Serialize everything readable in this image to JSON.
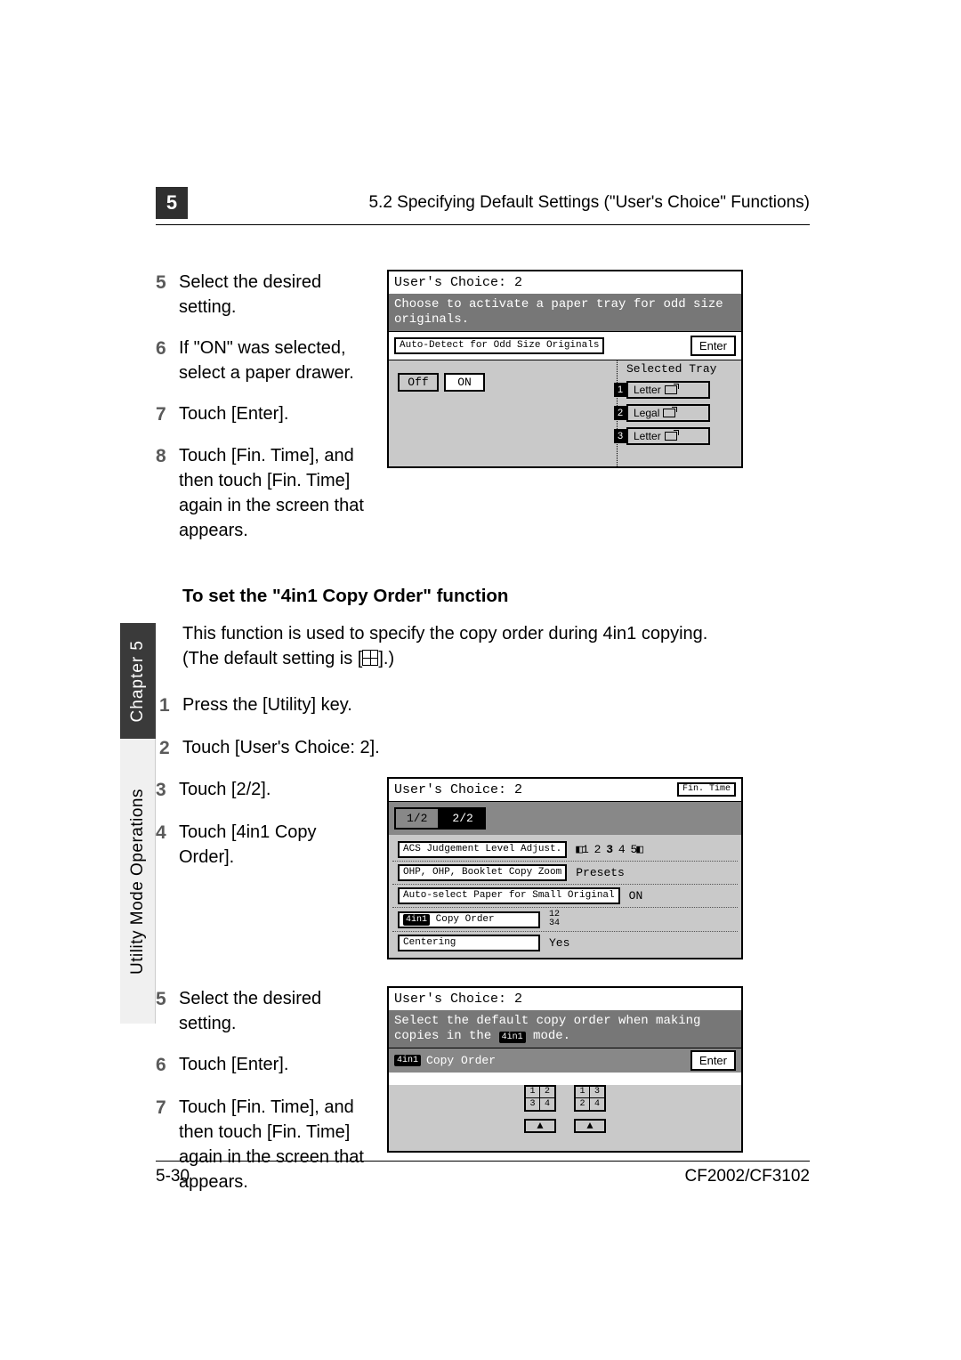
{
  "header": {
    "chapter_num": "5",
    "section_title": "5.2 Specifying Default Settings (\"User's Choice\" Functions)"
  },
  "side": {
    "dark": "Chapter 5",
    "light": "Utility Mode Operations"
  },
  "stepsA": {
    "s5": {
      "n": "5",
      "t": "Select the desired setting."
    },
    "s6": {
      "n": "6",
      "t": "If \"ON\" was selected, select a paper drawer."
    },
    "s7": {
      "n": "7",
      "t": "Touch [Enter]."
    },
    "s8": {
      "n": "8",
      "t": "Touch [Fin. Time], and then touch [Fin. Time] again in the screen that appears."
    }
  },
  "lcd1": {
    "title": "User's Choice: 2",
    "msg": "Choose to activate a paper tray for odd size originals.",
    "field": "Auto-Detect for Odd Size Originals",
    "enter": "Enter",
    "tray_label": "Selected Tray",
    "off": "Off",
    "on": "ON",
    "trays": [
      {
        "n": "1",
        "name": "Letter"
      },
      {
        "n": "2",
        "name": "Legal"
      },
      {
        "n": "3",
        "name": "Letter"
      }
    ]
  },
  "section2": {
    "heading": "To set the \"4in1 Copy Order\" function",
    "para1": "This function is used to specify the copy order during 4in1 copying.",
    "para2a": "(The default setting is [",
    "para2b": "].)"
  },
  "stepsB": {
    "s1": {
      "n": "1",
      "t": "Press the [Utility] key."
    },
    "s2": {
      "n": "2",
      "t": "Touch [User's Choice: 2]."
    },
    "s3": {
      "n": "3",
      "t": "Touch [2/2]."
    },
    "s4": {
      "n": "4",
      "t": "Touch [4in1 Copy Order]."
    }
  },
  "lcd2": {
    "title": "User's Choice: 2",
    "fin": "Fin. Time",
    "page1": "1/2",
    "page2": "2/2",
    "rows": [
      {
        "label": "ACS Judgement Level Adjust.",
        "value_type": "slider",
        "value": "12345"
      },
      {
        "label": "OHP, OHP, Booklet Copy Zoom",
        "value": "Presets"
      },
      {
        "label": "Auto-select Paper for Small Original",
        "value": "ON"
      },
      {
        "label": "4in1 Copy Order",
        "value": "12 34",
        "badge": "4in1"
      },
      {
        "label": "Centering",
        "value": "Yes"
      }
    ]
  },
  "stepsC": {
    "s5": {
      "n": "5",
      "t": "Select the desired setting."
    },
    "s6": {
      "n": "6",
      "t": "Touch [Enter]."
    },
    "s7": {
      "n": "7",
      "t": "Touch [Fin. Time], and then touch [Fin. Time] again in the screen that appears."
    }
  },
  "lcd3": {
    "title": "User's Choice: 2",
    "msg": "Select the default copy order when making copies in the 4in1 mode.",
    "head_badge": "4in1",
    "head_label": "Copy Order",
    "enter": "Enter",
    "opt1": [
      "1",
      "2",
      "3",
      "4"
    ],
    "opt2": [
      "1",
      "3",
      "2",
      "4"
    ]
  },
  "footer": {
    "left": "5-30",
    "right": "CF2002/CF3102"
  }
}
